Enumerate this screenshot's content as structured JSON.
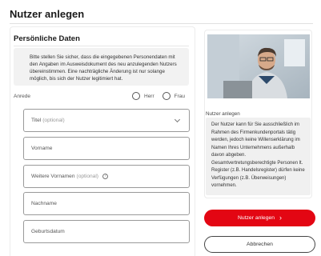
{
  "page": {
    "title": "Nutzer anlegen"
  },
  "section": {
    "title": "Persönliche Daten",
    "info_text": "Bitte stellen Sie sicher, dass die eingegebenen Personendaten mit den Angaben im Ausweisdokument des neu anzulegenden Nutzers übereinstimmen. Eine nachträgliche Änderung ist nur solange möglich, bis sich der Nutzer legitimiert hat."
  },
  "anrede": {
    "label": "Anrede",
    "options": [
      "Herr",
      "Frau"
    ]
  },
  "fields": {
    "titel": {
      "label": "Titel",
      "optional": "(optional)"
    },
    "vorname": {
      "label": "Vorname"
    },
    "weitere_vornamen": {
      "label": "Weitere Vornamen",
      "optional": "(optional)"
    },
    "nachname": {
      "label": "Nachname"
    },
    "geburtsdatum": {
      "label": "Geburtsdatum"
    }
  },
  "aside": {
    "caption": "Nutzer anlegen",
    "text": "Der Nutzer kann für Sie ausschließlich im Rahmen des Firmenkundenportals tätig werden, jedoch keine Willenserklärung im Namen Ihres Unternehmens außerhalb davon abgeben. Gesamtvertretungsberechtigte Personen lt. Register (z.B. Handelsregister) dürfen keine Verfügungen (z.B. Überweisungen) vornehmen."
  },
  "buttons": {
    "primary": "Nutzer anlegen",
    "secondary": "Abbrechen"
  },
  "colors": {
    "accent": "#e30613"
  }
}
